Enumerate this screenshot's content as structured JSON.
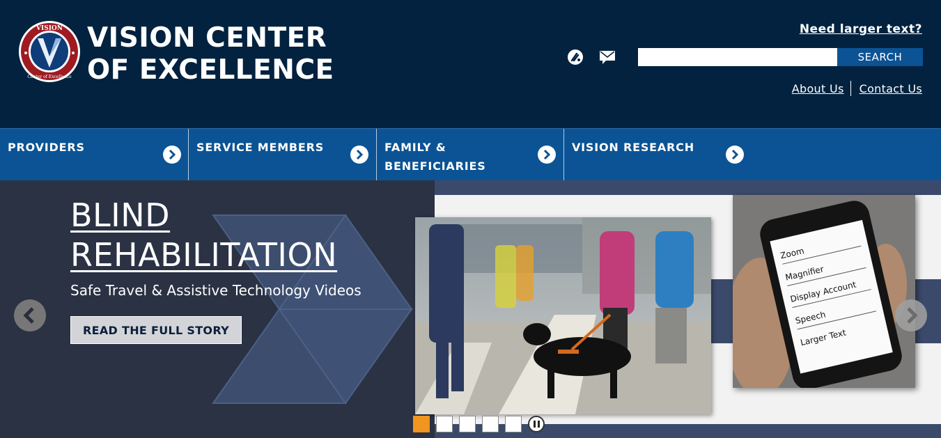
{
  "header": {
    "brand_line1": "VISION CENTER",
    "brand_line2": "OF EXCELLENCE",
    "logo_text_top": "VISION",
    "logo_text_bottom": "Center of Excellence",
    "larger_text_link": "Need larger text?",
    "search": {
      "placeholder": "",
      "value": "",
      "button_label": "SEARCH"
    },
    "links": [
      {
        "label": "About Us"
      },
      {
        "label": "Contact Us"
      }
    ],
    "icons": [
      "accessibility-icon",
      "email-icon"
    ]
  },
  "nav": {
    "items": [
      {
        "line1": "PROVIDERS",
        "line2": ""
      },
      {
        "line1": "SERVICE MEMBERS",
        "line2": ""
      },
      {
        "line1": "FAMILY &",
        "line2": "BENEFICIARIES"
      },
      {
        "line1": "VISION RESEARCH",
        "line2": ""
      }
    ]
  },
  "hero": {
    "title_line1": "BLIND",
    "title_line2": "REHABILITATION",
    "subtitle": "Safe Travel & Assistive Technology Videos",
    "button_label": "READ THE FULL STORY",
    "phone_menu": [
      "Zoom",
      "Magnifier",
      "Display Account",
      "Speech",
      "Larger Text"
    ],
    "slides": 5,
    "active_slide": 1
  },
  "colors": {
    "header_bg": "#02223f",
    "nav_bg": "#0b5394",
    "hero_bg": "#2a3244",
    "active_dot": "#f0951f"
  }
}
